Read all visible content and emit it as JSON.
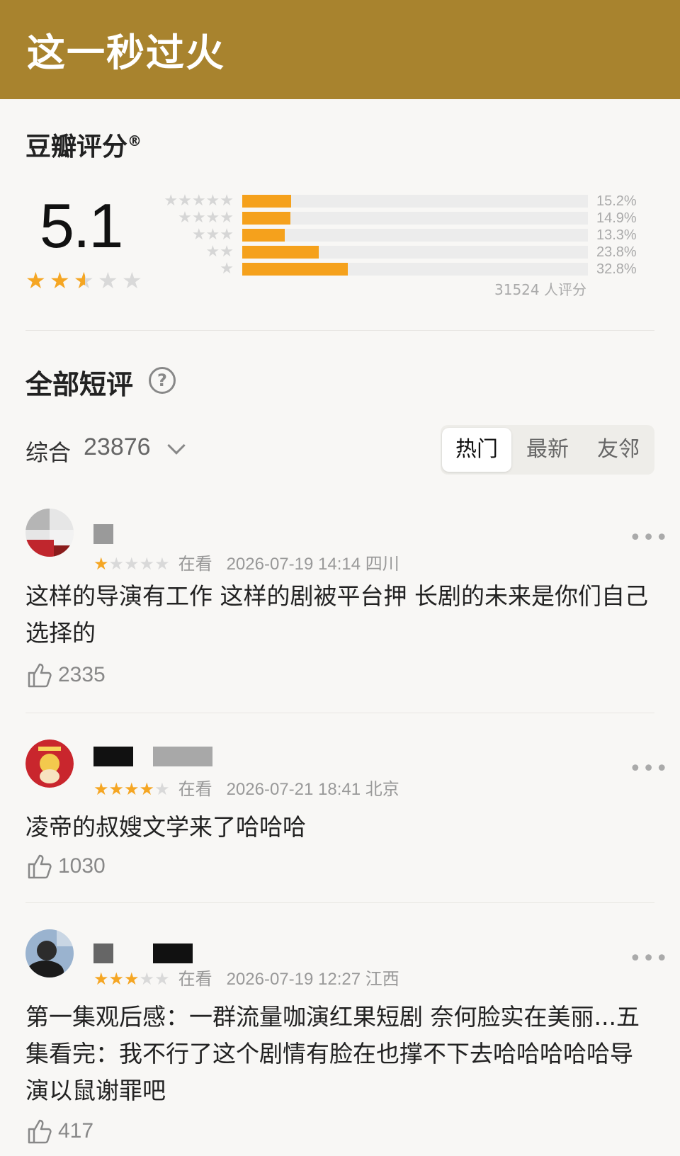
{
  "header": {
    "title": "这一秒过火",
    "bg_color": "#a8832e"
  },
  "rating": {
    "label": "豆瓣评分",
    "registered_mark": "®",
    "score": "5.1",
    "stars": 2.5,
    "distribution": [
      {
        "stars": 5,
        "percent": "15.2%",
        "value": 15.2
      },
      {
        "stars": 4,
        "percent": "14.9%",
        "value": 14.9
      },
      {
        "stars": 3,
        "percent": "13.3%",
        "value": 13.3
      },
      {
        "stars": 2,
        "percent": "23.8%",
        "value": 23.8
      },
      {
        "stars": 1,
        "percent": "32.8%",
        "value": 32.8
      }
    ],
    "rater_count": "31524 人评分",
    "accent_color": "#f5a623"
  },
  "reviews": {
    "title": "全部短评",
    "help_icon": "question-icon",
    "sort_label": "综合",
    "count": "23876",
    "tabs": [
      "热门",
      "最新",
      "友邻"
    ],
    "active_tab": 0
  },
  "comments": [
    {
      "stars": 1,
      "status": "在看",
      "time": "2026-07-19 14:14 四川",
      "text": "这样的导演有工作 这样的剧被平台押 长剧的未来是你们自己选择的",
      "likes": "2335"
    },
    {
      "stars": 4,
      "status": "在看",
      "time": "2026-07-21 18:41 北京",
      "text": "凌帝的叔嫂文学来了哈哈哈",
      "likes": "1030"
    },
    {
      "stars": 3,
      "status": "在看",
      "time": "2026-07-19 12:27 江西",
      "text": "第一集观后感：一群流量咖演红果短剧 奈何脸实在美丽...五集看完：我不行了这个剧情有脸在也撑不下去哈哈哈哈哈导演以鼠谢罪吧",
      "likes": "417"
    }
  ]
}
